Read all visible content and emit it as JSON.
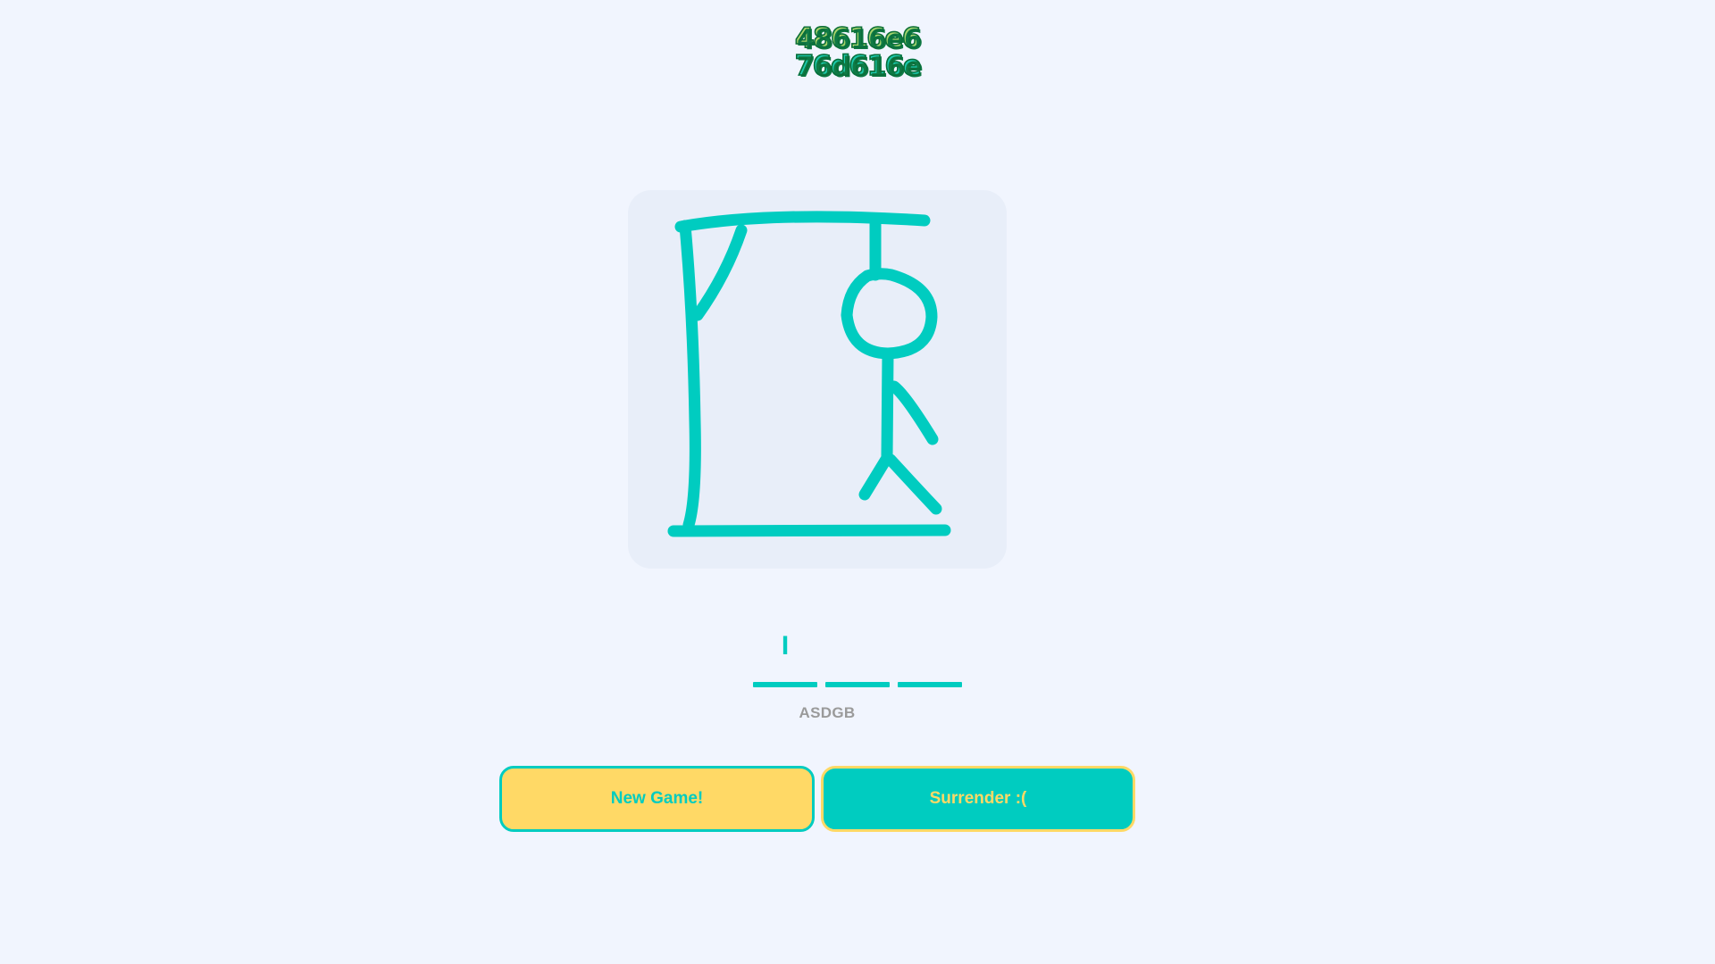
{
  "logo": {
    "line1": "48616e6",
    "line2": "76d616e"
  },
  "gallows": {
    "stroke_color": "#00ccc0",
    "wrong_guesses_drawn": [
      "base",
      "post",
      "beam",
      "brace",
      "rope",
      "head",
      "body",
      "arm",
      "leg-left",
      "leg-right"
    ]
  },
  "word": {
    "slots": [
      {
        "letter": "I"
      },
      {
        "letter": ""
      },
      {
        "letter": ""
      }
    ]
  },
  "guessed_letters": "ASDGB",
  "buttons": {
    "new_game": "New Game!",
    "surrender": "Surrender :("
  },
  "colors": {
    "background": "#f1f5fe",
    "accent_teal": "#00ccc0",
    "accent_yellow": "#ffd966",
    "panel": "#e8eef9"
  }
}
